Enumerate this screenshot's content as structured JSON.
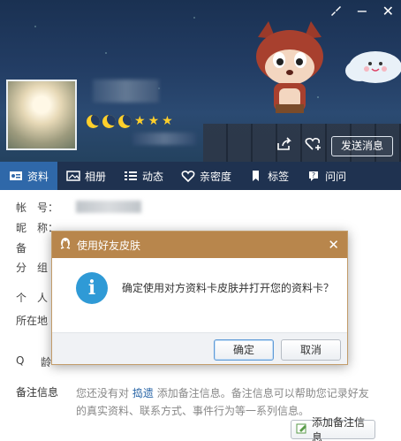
{
  "window": {
    "controls": {
      "skin_icon": "brush-icon",
      "minimize": "−",
      "close": "✕"
    }
  },
  "profile": {
    "level_icons": [
      "moon",
      "moon",
      "moon",
      "star",
      "star",
      "star"
    ],
    "send_message_label": "发送消息"
  },
  "tabs": [
    {
      "label": "资料",
      "icon": "profile-card-icon",
      "active": true
    },
    {
      "label": "相册",
      "icon": "photo-album-icon",
      "active": false
    },
    {
      "label": "动态",
      "icon": "feed-list-icon",
      "active": false
    },
    {
      "label": "亲密度",
      "icon": "heart-icon",
      "active": false
    },
    {
      "label": "标签",
      "icon": "bookmark-icon",
      "active": false
    },
    {
      "label": "问问",
      "icon": "question-icon",
      "active": false
    }
  ],
  "fields": {
    "account_label": "帐　号：",
    "nickname_label": "昵　称：",
    "remark_label_partial": "备",
    "group_label_partial": "分　组",
    "personal_label_partial": "个　人",
    "location_label_partial": "所在地",
    "q_label": "Q",
    "age_label_partial": "龄"
  },
  "note": {
    "label": "备注信息",
    "text_prefix": "您还没有对",
    "link_text": "捣遗",
    "text_suffix": "添加备注信息。备注信息可以帮助您记录好友的真实资料、联系方式、事件行为等一系列信息。",
    "add_button": "添加备注信息"
  },
  "dialog": {
    "title": "使用好友皮肤",
    "message": "确定使用对方资料卡皮肤并打开您的资料卡？",
    "ok": "确定",
    "cancel": "取消",
    "close": "✕"
  },
  "colors": {
    "header_bg": "#223c63",
    "tab_bar": "#1f3250",
    "tab_active": "#2f68a9",
    "dialog_title": "#b8864c",
    "info_icon": "#2f9ad6",
    "level_gold": "#ffcf2b"
  }
}
